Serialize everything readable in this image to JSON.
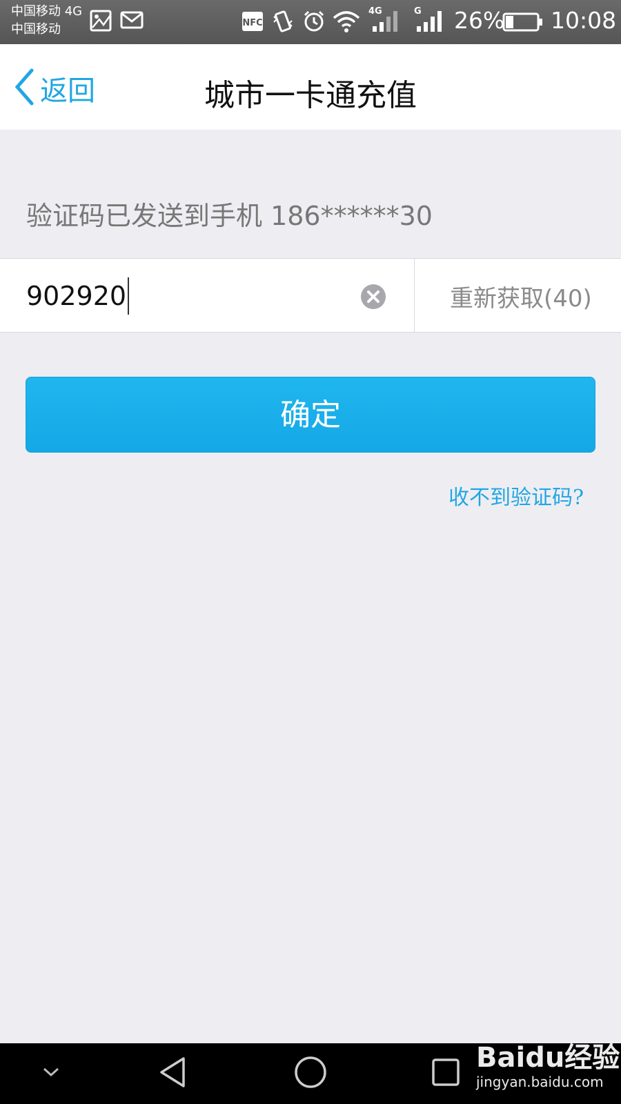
{
  "status_bar": {
    "carrier_line1": "中国移动 4G",
    "carrier_line2": "中国移动",
    "nfc_label": "NFC",
    "signal1_label": "4G",
    "signal2_label": "G",
    "battery_percent": "26%",
    "battery_level": 0.26,
    "time": "10:08"
  },
  "navbar": {
    "back_label": "返回",
    "title": "城市一卡通充值"
  },
  "verification": {
    "sent_message": "验证码已发送到手机 186******30",
    "code_value": "902920",
    "resend_label": "重新获取(40)",
    "confirm_label": "确定",
    "no_code_label": "收不到验证码?"
  },
  "watermark": {
    "brand": "Baidu经验",
    "url": "jingyan.baidu.com"
  },
  "colors": {
    "accent": "#21a6e4",
    "button": "#1ab2ec",
    "background": "#eeeef2"
  }
}
